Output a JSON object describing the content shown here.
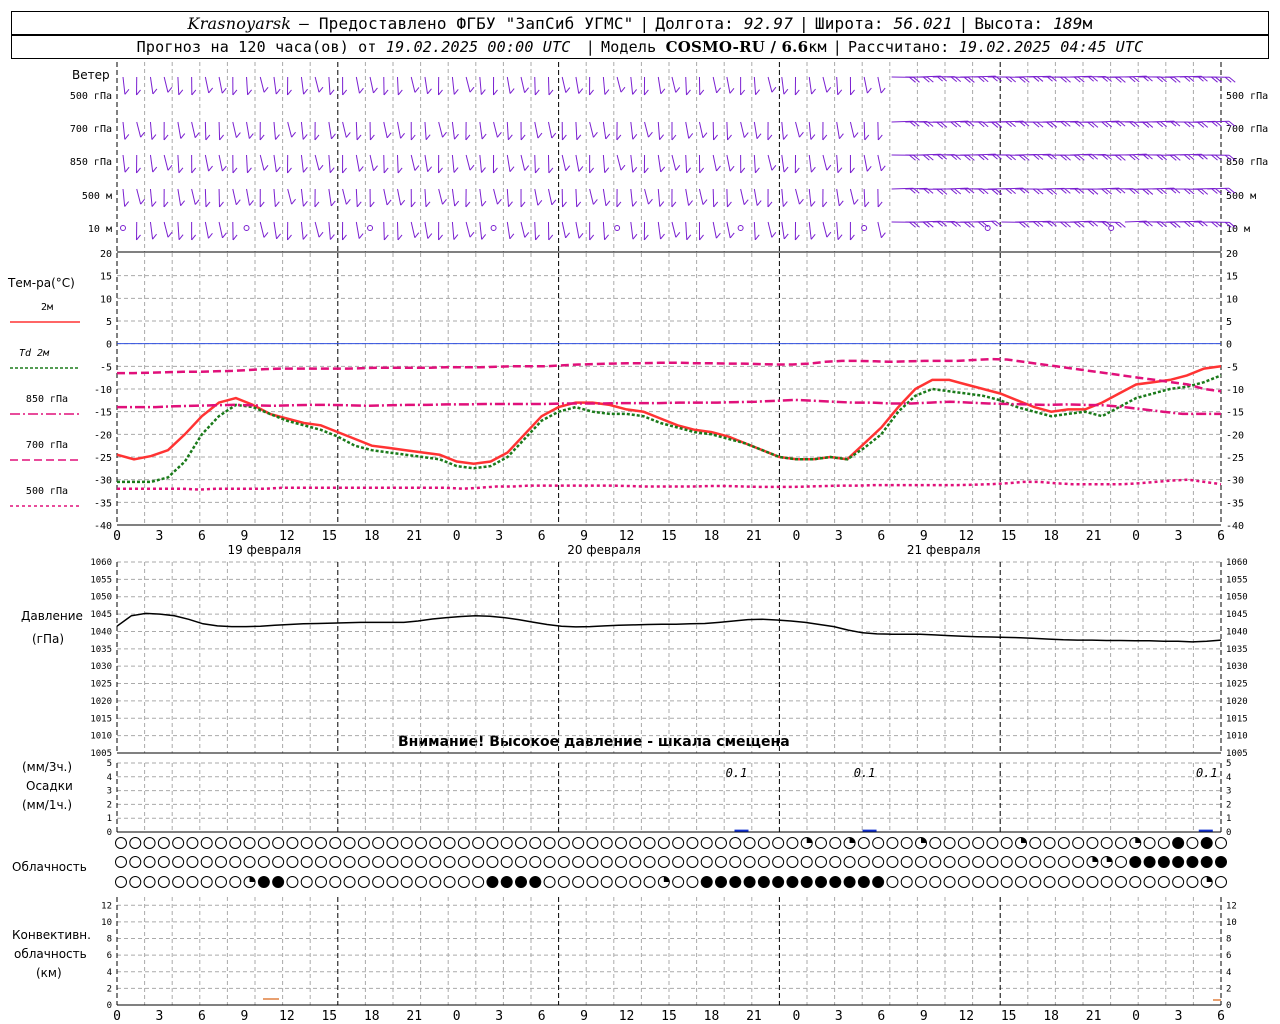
{
  "header": {
    "city": "Krasnoyarsk",
    "provider": "— Предоставлено ФГБУ \"ЗапСиб УГМС\"",
    "lon_label": "Долгота:",
    "lon": "92.97",
    "lat_label": "Широта:",
    "lat": "56.021",
    "alt_label": "Высота:",
    "alt": "189",
    "alt_unit": "м",
    "forecast_prefix": "Прогноз на 120 часа(ов) от",
    "forecast_start": "19.02.2025 00:00 UTC",
    "model_label": "Модель",
    "model": "COSMO-RU / 6.6",
    "model_unit": "км",
    "computed_label": "Рассчитано:",
    "computed": "19.02.2025 04:45 UTC"
  },
  "labels": {
    "wind": "Ветер",
    "levels": [
      "500 гПа",
      "700 гПа",
      "850 гПа",
      "500 м",
      "10 м"
    ],
    "temp_title": "Тем-ра(°C)",
    "legend": [
      {
        "name": "2м",
        "color": "#ff3333",
        "dash": "none"
      },
      {
        "name": "Td 2м",
        "color": "#1a7a1a",
        "dash": "3,2"
      },
      {
        "name": "850 гПа",
        "color": "#e0107a",
        "dash": "10,3,2,3"
      },
      {
        "name": "700 гПа",
        "color": "#e0107a",
        "dash": "8,4"
      },
      {
        "name": "500 гПа",
        "color": "#e0107a",
        "dash": "3,3"
      }
    ],
    "pressure_title": "Давление",
    "pressure_unit": "(гПа)",
    "pressure_warning": "Внимание! Высокое давление - шкала смещена",
    "precip_unit3": "(мм/3ч.)",
    "precip_title": "Осадки",
    "precip_unit1": "(мм/1ч.)",
    "cloud_title": "Облачность",
    "conv_title1": "Конвективн.",
    "conv_title2": "облачность",
    "conv_unit": "(км)"
  },
  "dates": [
    "19 февраля",
    "20 февраля",
    "21 февраля"
  ],
  "colors": {
    "wind": "#7a1fd0",
    "grid": "#aaaaaa",
    "pressure": "#000000",
    "precip": "#1030d0",
    "conv": "#e08040"
  },
  "chart_data": [
    {
      "type": "line",
      "title": "Тем-ра(°C)",
      "x": [
        "0",
        "3",
        "6",
        "9",
        "12",
        "15",
        "18",
        "21",
        "0",
        "3",
        "6",
        "9",
        "12",
        "15",
        "18",
        "21",
        "0",
        "3",
        "6",
        "9",
        "12",
        "15",
        "18",
        "21",
        "0",
        "3",
        "6"
      ],
      "ylim": [
        -40,
        20
      ],
      "yticks": [
        20,
        15,
        10,
        5,
        0,
        -5,
        -10,
        -15,
        -20,
        -25,
        -30,
        -35,
        -40
      ],
      "series": [
        {
          "name": "2м",
          "values": [
            -24.5,
            -25.5,
            -24.8,
            -23.5,
            -20,
            -16,
            -13,
            -12,
            -13.5,
            -15.5,
            -16.5,
            -17.5,
            -18,
            -19.5,
            -21,
            -22.5,
            -23,
            -23.5,
            -24,
            -24.5,
            -26,
            -26.5,
            -26,
            -24,
            -20,
            -16,
            -14,
            -13,
            -13,
            -13.5,
            -14.5,
            -15,
            -16.5,
            -18,
            -19,
            -19.5,
            -20.5,
            -22,
            -23.5,
            -25,
            -25.5,
            -25.5,
            -25,
            -25.5,
            -22,
            -18.5,
            -14,
            -10,
            -8,
            -8,
            -9,
            -10,
            -11,
            -12.5,
            -14,
            -15,
            -14.5,
            -14.5,
            -13,
            -11,
            -9,
            -8.5,
            -8,
            -7,
            -5.5,
            -5
          ]
        },
        {
          "name": "Td 2м",
          "values": [
            -30.5,
            -30.5,
            -30.5,
            -29.5,
            -26,
            -20,
            -16,
            -13.5,
            -14,
            -15.5,
            -17,
            -18,
            -19,
            -20.5,
            -22.5,
            -23.5,
            -24,
            -24.5,
            -25,
            -25.5,
            -27,
            -27.5,
            -27,
            -25,
            -21,
            -17,
            -15,
            -14,
            -15,
            -15.5,
            -15.5,
            -16,
            -17.5,
            -18.5,
            -19.5,
            -20,
            -21,
            -22,
            -23.5,
            -25,
            -25.5,
            -25.5,
            -25,
            -25.5,
            -23,
            -20,
            -15,
            -11.5,
            -10,
            -10.5,
            -11,
            -11.5,
            -12.5,
            -14,
            -15,
            -16,
            -15.5,
            -15,
            -16,
            -14,
            -12,
            -11,
            -10,
            -9.5,
            -8.5,
            -7
          ]
        },
        {
          "name": "850 гПа",
          "values": [
            -14,
            -14,
            -14,
            -13.8,
            -13.7,
            -13.6,
            -13.5,
            -13.6,
            -13.7,
            -13.6,
            -13.5,
            -13.5,
            -13.6,
            -13.7,
            -13.6,
            -13.5,
            -13.5,
            -13.4,
            -13.4,
            -13.3,
            -13.3,
            -13.3,
            -13.3,
            -13.2,
            -13.2,
            -13.2,
            -13.1,
            -13.1,
            -13.1,
            -13,
            -13,
            -13,
            -12.9,
            -12.8,
            -12.6,
            -12.4,
            -12.6,
            -12.8,
            -13,
            -13,
            -13.2,
            -13.2,
            -13,
            -12.8,
            -13,
            -13.2,
            -13.3,
            -13.4,
            -13.5,
            -13.4,
            -13.5,
            -13.6,
            -14,
            -14.5,
            -15,
            -15.5,
            -15.5,
            -15.5
          ]
        },
        {
          "name": "700 гПа",
          "values": [
            -6.5,
            -6.5,
            -6.4,
            -6.3,
            -6.2,
            -6.2,
            -6.1,
            -6,
            -5.8,
            -5.6,
            -5.5,
            -5.5,
            -5.5,
            -5.5,
            -5.5,
            -5.4,
            -5.3,
            -5.3,
            -5.3,
            -5.3,
            -5.2,
            -5.2,
            -5.2,
            -5.1,
            -5,
            -5,
            -5,
            -4.8,
            -4.6,
            -4.5,
            -4.4,
            -4.3,
            -4.3,
            -4.2,
            -4.2,
            -4.3,
            -4.3,
            -4.4,
            -4.4,
            -4.5,
            -4.6,
            -4.6,
            -4.4,
            -4,
            -3.8,
            -3.8,
            -3.9,
            -4,
            -3.9,
            -3.8,
            -3.8,
            -3.8,
            -3.6,
            -3.4,
            -3.5,
            -4,
            -4.5,
            -5,
            -5.5,
            -6,
            -6.5,
            -7,
            -7.5,
            -8,
            -8.5,
            -9,
            -10,
            -10.5
          ]
        },
        {
          "name": "500 гПа",
          "values": [
            -32,
            -32,
            -32,
            -32,
            -32,
            -32.2,
            -32,
            -32,
            -32,
            -32,
            -31.8,
            -31.8,
            -31.8,
            -31.8,
            -31.8,
            -31.8,
            -31.8,
            -31.8,
            -31.8,
            -31.8,
            -31.8,
            -32,
            -31.8,
            -31.5,
            -31.5,
            -31.3,
            -31.3,
            -31.3,
            -31.3,
            -31.3,
            -31.3,
            -31.4,
            -31.5,
            -31.5,
            -31.5,
            -31.5,
            -31.4,
            -31.4,
            -31.5,
            -31.6,
            -31.6,
            -31.6,
            -31.5,
            -31.4,
            -31.3,
            -31.3,
            -31.2,
            -31.2,
            -31.2,
            -31.2,
            -31.2,
            -31.2,
            -31.1,
            -31,
            -30.8,
            -30.5,
            -30.5,
            -30.8,
            -31,
            -31,
            -31,
            -31,
            -30.8,
            -30.5,
            -30.2,
            -30,
            -30.5,
            -31
          ]
        }
      ]
    },
    {
      "type": "line",
      "title": "Давление",
      "ylim": [
        1005,
        1060
      ],
      "yticks": [
        1060,
        1055,
        1050,
        1045,
        1040,
        1035,
        1030,
        1025,
        1020,
        1015,
        1010,
        1005
      ],
      "series": [
        {
          "name": "Давление",
          "values": [
            1041.5,
            1044.5,
            1045.2,
            1045,
            1044.5,
            1043.5,
            1042.2,
            1041.6,
            1041.4,
            1041.4,
            1041.5,
            1041.8,
            1042,
            1042.2,
            1042.3,
            1042.4,
            1042.5,
            1042.6,
            1042.6,
            1042.6,
            1042.6,
            1043,
            1043.6,
            1044,
            1044.3,
            1044.5,
            1044.4,
            1044,
            1043.4,
            1042.7,
            1042,
            1041.5,
            1041.3,
            1041.4,
            1041.6,
            1041.8,
            1041.9,
            1042,
            1042.1,
            1042.1,
            1042.2,
            1042.3,
            1042.6,
            1043,
            1043.4,
            1043.5,
            1043.3,
            1043,
            1042.6,
            1042,
            1041.4,
            1040.4,
            1039.6,
            1039.3,
            1039.2,
            1039.2,
            1039.2,
            1039,
            1038.8,
            1038.6,
            1038.5,
            1038.4,
            1038.3,
            1038.2,
            1038,
            1037.8,
            1037.6,
            1037.5,
            1037.5,
            1037.4,
            1037.4,
            1037.3,
            1037.3,
            1037.2,
            1037.2,
            1037,
            1037.2,
            1037.5
          ]
        }
      ]
    },
    {
      "type": "bar",
      "title": "Осадки",
      "ylim": [
        0,
        5
      ],
      "yticks": [
        5,
        4,
        3,
        2,
        1,
        0
      ],
      "annotations": [
        "0.1",
        "0.1",
        "0.1"
      ],
      "series": [
        {
          "name": "Осадки",
          "values": [
            0.1,
            0.1,
            0.1
          ]
        }
      ]
    },
    {
      "type": "bar",
      "title": "Конвективн. облачность",
      "ylim": [
        0,
        13
      ],
      "yticks": [
        12,
        10,
        8,
        6,
        4,
        2,
        0
      ]
    }
  ]
}
